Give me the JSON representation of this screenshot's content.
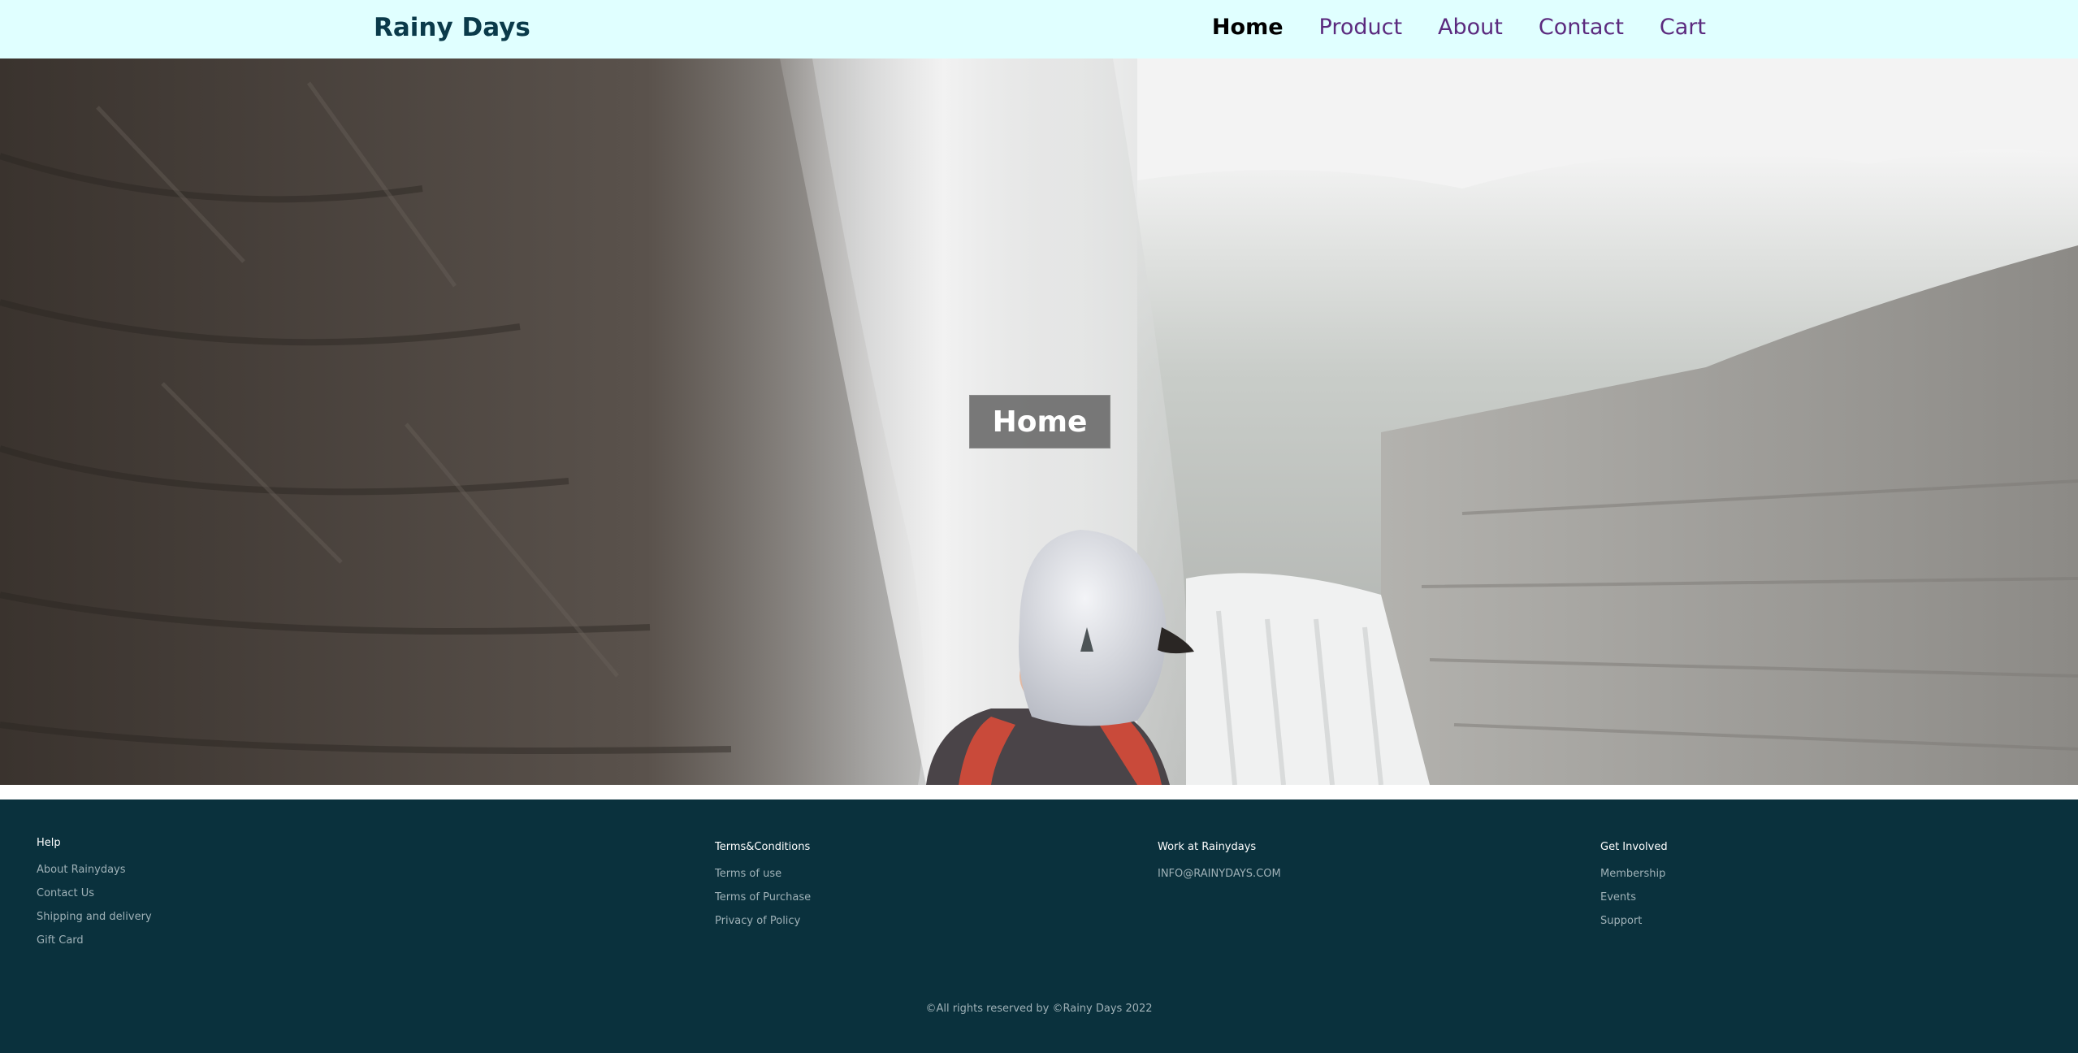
{
  "header": {
    "brand": "Rainy Days",
    "nav": [
      {
        "label": "Home",
        "active": true
      },
      {
        "label": "Product",
        "active": false
      },
      {
        "label": "About",
        "active": false
      },
      {
        "label": "Contact",
        "active": false
      },
      {
        "label": "Cart",
        "active": false
      }
    ]
  },
  "hero": {
    "title": "Home"
  },
  "footer": {
    "columns": [
      {
        "heading": "Help",
        "links": [
          "About Rainydays",
          "Contact Us",
          "Shipping and delivery",
          "Gift Card"
        ]
      },
      {
        "heading": "Terms&Conditions",
        "links": [
          "Terms of use",
          "Terms of Purchase",
          "Privacy of Policy"
        ]
      },
      {
        "heading": "Work at Rainydays",
        "links": [
          "INFO@RAINYDAYS.COM"
        ]
      },
      {
        "heading": "Get Involved",
        "links": [
          "Membership",
          "Events",
          "Support"
        ]
      }
    ],
    "copyright": "©All rights reserved by ©Rainy Days 2022"
  },
  "colors": {
    "header_bg": "#e0ffff",
    "brand": "#0a3a4a",
    "nav_link": "#5b2a7e",
    "footer_bg": "#0a313d"
  }
}
